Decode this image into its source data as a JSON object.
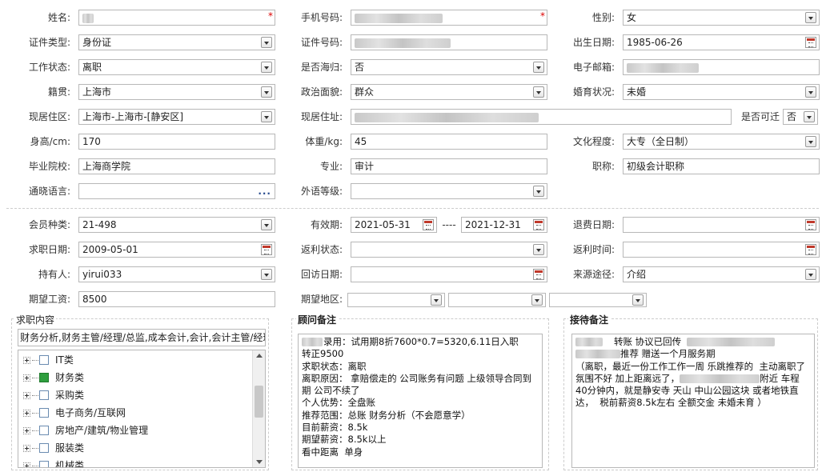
{
  "row1": {
    "name": {
      "label": "姓名:",
      "value": "",
      "required_mark": "*"
    },
    "phone": {
      "label": "手机号码:",
      "value": "",
      "required_mark": "*"
    },
    "gender": {
      "label": "性别:",
      "value": "女"
    }
  },
  "row2": {
    "id_type": {
      "label": "证件类型:",
      "value": "身份证"
    },
    "id_no": {
      "label": "证件号码:",
      "value": ""
    },
    "birth": {
      "label": "出生日期:",
      "value": "1985-06-26"
    }
  },
  "row3": {
    "work_status": {
      "label": "工作状态:",
      "value": "离职"
    },
    "returnee": {
      "label": "是否海归:",
      "value": "否"
    },
    "email": {
      "label": "电子邮箱:",
      "value": ""
    }
  },
  "row4": {
    "native": {
      "label": "籍贯:",
      "value": "上海市"
    },
    "political": {
      "label": "政治面貌:",
      "value": "群众"
    },
    "marital": {
      "label": "婚育状况:",
      "value": "未婚"
    }
  },
  "row5": {
    "residence": {
      "label": "现居住区:",
      "value": "上海市-上海市-[静安区]"
    },
    "address": {
      "label": "现居住址:",
      "value": ""
    },
    "relocate": {
      "label": "是否可迁",
      "value": "否"
    }
  },
  "row6": {
    "height": {
      "label": "身高/cm:",
      "value": "170"
    },
    "weight": {
      "label": "体重/kg:",
      "value": "45"
    },
    "education": {
      "label": "文化程度:",
      "value": "大专（全日制）"
    }
  },
  "row7": {
    "school": {
      "label": "毕业院校:",
      "value": "上海商学院"
    },
    "major": {
      "label": "专业:",
      "value": "审计"
    },
    "title": {
      "label": "职称:",
      "value": "初级会计职称"
    }
  },
  "row8": {
    "language": {
      "label": "通晓语言:",
      "value": "",
      "icon": "..."
    },
    "foreign_level": {
      "label": "外语等级:",
      "value": ""
    }
  },
  "row9": {
    "member_type": {
      "label": "会员种类:",
      "value": "21-498"
    },
    "valid": {
      "label": "有效期:",
      "start": "2021-05-31",
      "sep": "----",
      "end": "2021-12-31"
    },
    "refund_date": {
      "label": "退费日期:",
      "value": ""
    }
  },
  "row10": {
    "apply_date": {
      "label": "求职日期:",
      "value": "2009-05-01"
    },
    "rebate_status": {
      "label": "返利状态:",
      "value": ""
    },
    "rebate_time": {
      "label": "返利时间:",
      "value": ""
    }
  },
  "row11": {
    "holder": {
      "label": "持有人:",
      "value": "yirui033"
    },
    "visit_date": {
      "label": "回访日期:",
      "value": ""
    },
    "source": {
      "label": "来源途径:",
      "value": "介绍"
    }
  },
  "row12": {
    "salary": {
      "label": "期望工资:",
      "value": "8500"
    },
    "area": {
      "label": "期望地区:",
      "value1": "",
      "value2": "",
      "value3": ""
    }
  },
  "job_panel": {
    "title": "求职内容",
    "summary": "财务分析,财务主管/经理/总监,成本会计,会计,会计主管/经理",
    "items": [
      {
        "label": "IT类",
        "checked": false
      },
      {
        "label": "财务类",
        "checked": true
      },
      {
        "label": "采购类",
        "checked": false
      },
      {
        "label": "电子商务/互联网",
        "checked": false
      },
      {
        "label": "房地产/建筑/物业管理",
        "checked": false
      },
      {
        "label": "服装类",
        "checked": false
      },
      {
        "label": "机械类",
        "checked": false
      }
    ]
  },
  "advisor_panel": {
    "title": "顾问备注",
    "text": "录用：试用期8折7600*0.7=5320,6.11日入职\n转正9500\n求职状态：离职\n离职原因： 拿赔偿走的 公司账务有问题 上级领导合同到期 公司不续了\n个人优势：全盘账\n推荐范围：总账 财务分析（不会愿意学）\n目前薪资：8.5k\n期望薪资：8.5k以上\n看中距离  单身"
  },
  "reception_panel": {
    "title": "接待备注",
    "line1": "转账 协议已回传",
    "line2": "推荐 赠送一个月服务期",
    "line3a": "（离职，最近一份工作工作一周 乐跳推荐的  主动离职了 氛围不好 加上距离远了，",
    "line3b": "附近 车程40分钟内，就是静安寺 天山 中山公园这块 或者地铁直达，  税前薪资8.5k左右 全额交金 未婚未育 ）"
  }
}
